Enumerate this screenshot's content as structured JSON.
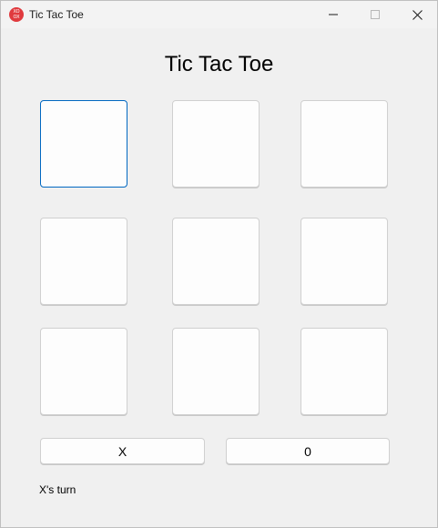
{
  "window": {
    "title": "Tic Tac Toe",
    "icon": "app-logo-icon",
    "icon_glyph": "XO\nOX",
    "accent_color": "#0067c0",
    "icon_color": "#e03a3e"
  },
  "game": {
    "heading": "Tic Tac Toe",
    "board": [
      "",
      "",
      "",
      "",
      "",
      "",
      "",
      "",
      ""
    ],
    "focused_cell": 0
  },
  "scores": {
    "x_label": "X",
    "o_label": "0"
  },
  "status": {
    "text": "X's turn"
  }
}
